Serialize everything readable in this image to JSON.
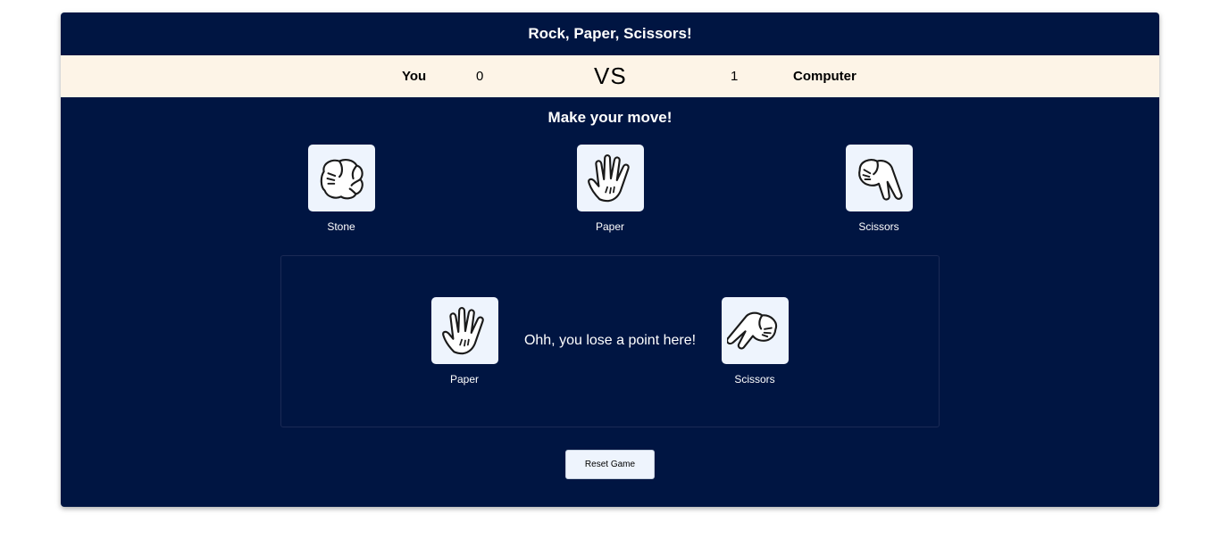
{
  "title": "Rock, Paper, Scissors!",
  "scoreboard": {
    "player_label": "You",
    "player_score": "0",
    "vs_label": "VS",
    "computer_score": "1",
    "computer_label": "Computer"
  },
  "prompt": "Make your move!",
  "choices": [
    {
      "label": "Stone",
      "icon": "fist-hand-icon"
    },
    {
      "label": "Paper",
      "icon": "open-hand-icon"
    },
    {
      "label": "Scissors",
      "icon": "scissors-hand-icon"
    }
  ],
  "result": {
    "player_choice": "Paper",
    "player_icon": "open-hand-icon",
    "message": "Ohh, you lose a point here!",
    "computer_choice": "Scissors",
    "computer_icon": "scissors-hand-icon"
  },
  "reset_label": "Reset Game",
  "colors": {
    "background": "#001542",
    "score_bar": "#fdf4e7",
    "tile": "#eef4fd"
  }
}
